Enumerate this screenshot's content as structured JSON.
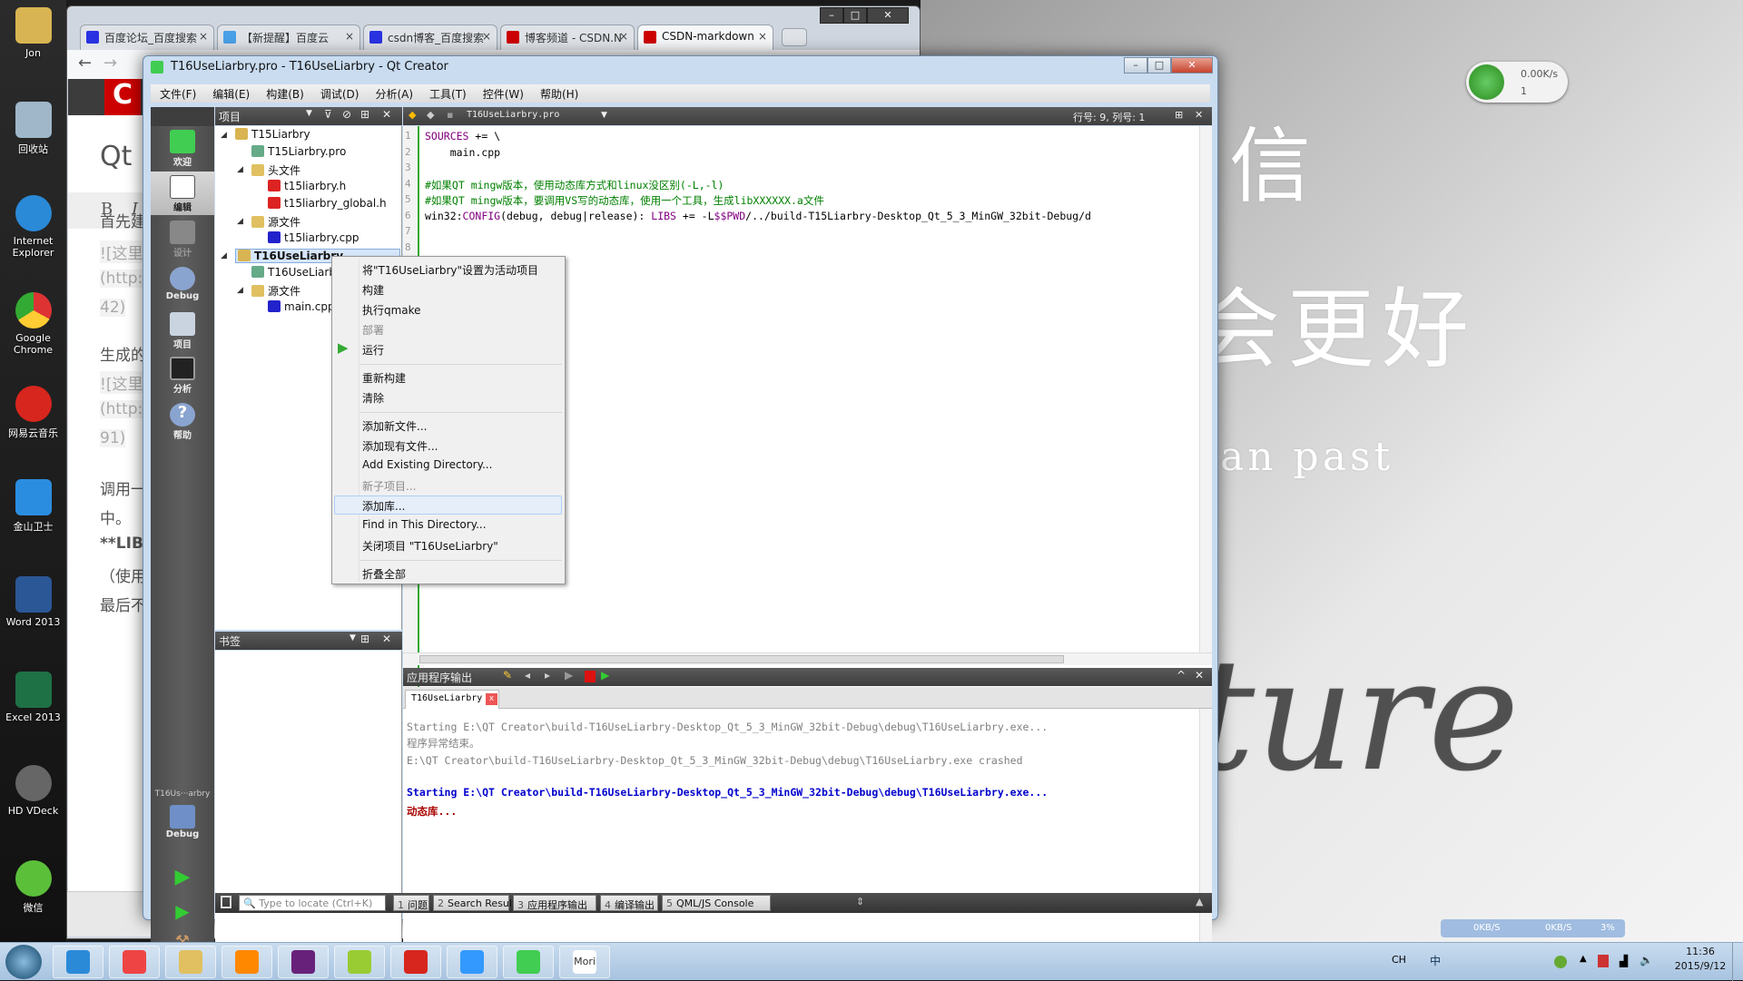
{
  "desktop": {
    "icons": [
      "Jon",
      "回收站",
      "Internet Explorer",
      "Google Chrome",
      "网易云音乐",
      "金山卫士",
      "Word 2013",
      "Excel 2013",
      "HD VDeck",
      "微信"
    ],
    "wallpaper_text": [
      "信",
      "会更好",
      "an past",
      "ture"
    ]
  },
  "net_widget": {
    "speed": "0.00K/s",
    "devices": "1"
  },
  "speed_widget": {
    "down": "0KB/S",
    "up": "0KB/S",
    "cpu": "3%"
  },
  "browser": {
    "tabs": [
      "百度论坛_百度搜索",
      "【新提醒】百度云",
      "csdn博客_百度搜索",
      "博客频道 - CSDN.N",
      "CSDN-markdown"
    ],
    "content": {
      "heading": "Qt",
      "toolbar": [
        "B",
        "I"
      ],
      "lines": [
        "首先建",
        "![这里",
        "(http:",
        "42)",
        "生成的",
        "![这里",
        "(http:",
        "91)",
        "调用一",
        "中。",
        "**LIB",
        "（使用",
        "最后不"
      ]
    }
  },
  "qt": {
    "title": "T16UseLiarbry.pro - T16UseLiarbry - Qt Creator",
    "menu": [
      "文件(F)",
      "编辑(E)",
      "构建(B)",
      "调试(D)",
      "分析(A)",
      "工具(T)",
      "控件(W)",
      "帮助(H)"
    ],
    "modes": [
      "欢迎",
      "编辑",
      "设计",
      "Debug",
      "项目",
      "分析",
      "帮助"
    ],
    "kit": {
      "project": "T16Us···arbry",
      "mode": "Debug"
    },
    "project_panel": {
      "title": "项目",
      "tree": [
        {
          "label": "T15Liarbry",
          "level": 0,
          "icon": "qt-project-icon"
        },
        {
          "label": "T15Liarbry.pro",
          "level": 1,
          "icon": "pro-file-icon"
        },
        {
          "label": "头文件",
          "level": 1,
          "icon": "header-folder-icon"
        },
        {
          "label": "t15liarbry.h",
          "level": 2,
          "icon": "header-file-icon"
        },
        {
          "label": "t15liarbry_global.h",
          "level": 2,
          "icon": "header-file-icon"
        },
        {
          "label": "源文件",
          "level": 1,
          "icon": "source-folder-icon"
        },
        {
          "label": "t15liarbry.cpp",
          "level": 2,
          "icon": "cpp-file-icon"
        },
        {
          "label": "T16UseLiarbry",
          "level": 0,
          "icon": "qt-project-icon",
          "selected": true
        },
        {
          "label": "T16UseLiarbry.pro",
          "level": 1,
          "icon": "pro-file-icon"
        },
        {
          "label": "源文件",
          "level": 1,
          "icon": "source-folder-icon"
        },
        {
          "label": "main.cpp",
          "level": 2,
          "icon": "cpp-file-icon"
        }
      ]
    },
    "bookmarks_title": "书签",
    "editor": {
      "file": "T16UseLiarbry.pro",
      "position": "行号: 9, 列号: 1",
      "lines": [
        [
          {
            "t": "SOURCES",
            "c": "kw"
          },
          {
            "t": " += \\"
          }
        ],
        [
          {
            "t": "    main.cpp"
          }
        ],
        [],
        [
          {
            "t": "#如果QT mingw版本，使用动态库方式和linux没区别(-L,-l)",
            "c": "cm"
          }
        ],
        [
          {
            "t": "#如果QT mingw版本，要调用VS写的动态库，使用一个工具，生成libXXXXXX.a文件",
            "c": "cm"
          }
        ],
        [
          {
            "t": "win32:"
          },
          {
            "t": "CONFIG",
            "c": "kw"
          },
          {
            "t": "(debug, debug|release): "
          },
          {
            "t": "LIBS",
            "c": "kw"
          },
          {
            "t": " += -L"
          },
          {
            "t": "$$PWD",
            "c": "kw"
          },
          {
            "t": "/../build-T15Liarbry-Desktop_Qt_5_3_MinGW_32bit-Debug/d"
          }
        ],
        [],
        []
      ]
    },
    "context_menu": {
      "items": [
        {
          "label": "将\"T16UseLiarbry\"设置为活动项目"
        },
        {
          "label": "构建"
        },
        {
          "label": "执行qmake"
        },
        {
          "label": "部署",
          "disabled": true
        },
        {
          "label": "运行",
          "icon": "run-icon"
        },
        {
          "sep": true
        },
        {
          "label": "重新构建"
        },
        {
          "label": "清除"
        },
        {
          "sep": true
        },
        {
          "label": "添加新文件..."
        },
        {
          "label": "添加现有文件..."
        },
        {
          "label": "Add Existing Directory..."
        },
        {
          "label": "新子项目...",
          "disabled": true
        },
        {
          "label": "添加库...",
          "highlighted": true
        },
        {
          "label": "Find in This Directory..."
        },
        {
          "label": "关闭项目 \"T16UseLiarbry\""
        },
        {
          "sep": true
        },
        {
          "label": "折叠全部"
        }
      ]
    },
    "output": {
      "title": "应用程序输出",
      "tab": "T16UseLiarbry",
      "lines": [
        {
          "t": "Starting E:\\QT Creator\\build-T16UseLiarbry-Desktop_Qt_5_3_MinGW_32bit-Debug\\debug\\T16UseLiarbry.exe...",
          "color": "#808080"
        },
        {
          "t": "程序异常结束。",
          "color": "#808080"
        },
        {
          "t": "E:\\QT Creator\\build-T16UseLiarbry-Desktop_Qt_5_3_MinGW_32bit-Debug\\debug\\T16UseLiarbry.exe crashed",
          "color": "#808080"
        },
        {
          "t": "",
          "color": "#000"
        },
        {
          "t": "Starting E:\\QT Creator\\build-T16UseLiarbry-Desktop_Qt_5_3_MinGW_32bit-Debug\\debug\\T16UseLiarbry.exe...",
          "color": "#0000cc"
        },
        {
          "t": "动态库...",
          "color": "#aa0000"
        }
      ]
    },
    "bottom": {
      "locator_placeholder": "Type to locate (Ctrl+K)",
      "panes": [
        {
          "n": "1",
          "l": "问题"
        },
        {
          "n": "2",
          "l": "Search Results"
        },
        {
          "n": "3",
          "l": "应用程序输出"
        },
        {
          "n": "4",
          "l": "编译输出"
        },
        {
          "n": "5",
          "l": "QML/JS Console"
        }
      ]
    }
  },
  "taskbar": {
    "apps": [
      "internet-explorer",
      "chrome",
      "file-explorer",
      "media-player",
      "visual-studio",
      "notepad",
      "netease-music",
      "media-play",
      "qt-creator",
      "Mori"
    ],
    "tray": {
      "lang": "CH",
      "ime": "中",
      "time": "11:36",
      "date": "2015/9/12"
    }
  }
}
